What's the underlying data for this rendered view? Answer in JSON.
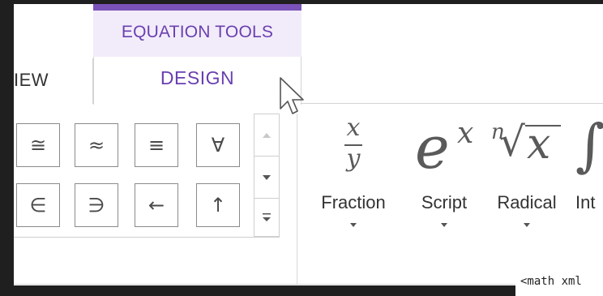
{
  "ribbon": {
    "prev_tab_label": "IEW",
    "contextual_group_label": "EQUATION TOOLS",
    "active_tab_label": "DESIGN",
    "accent_color": "#7a52b8",
    "accent_text_color": "#6a3fb0"
  },
  "symbols": {
    "row1": [
      "≅",
      "≈",
      "≡",
      "∀"
    ],
    "row2": [
      "∈",
      "∋",
      "←",
      "↑"
    ],
    "scroll_up": "▲",
    "scroll_down": "▼",
    "scroll_more": "more"
  },
  "structures": [
    {
      "label": "Fraction",
      "glyph_num": "x",
      "glyph_den": "y"
    },
    {
      "label": "Script",
      "glyph_base": "e",
      "glyph_sup": "x"
    },
    {
      "label": "Radical",
      "glyph_index": "n",
      "glyph_sign": "√",
      "glyph_x": "x"
    },
    {
      "label": "Int",
      "glyph": "∫"
    }
  ],
  "code_snippet": "<math xml"
}
